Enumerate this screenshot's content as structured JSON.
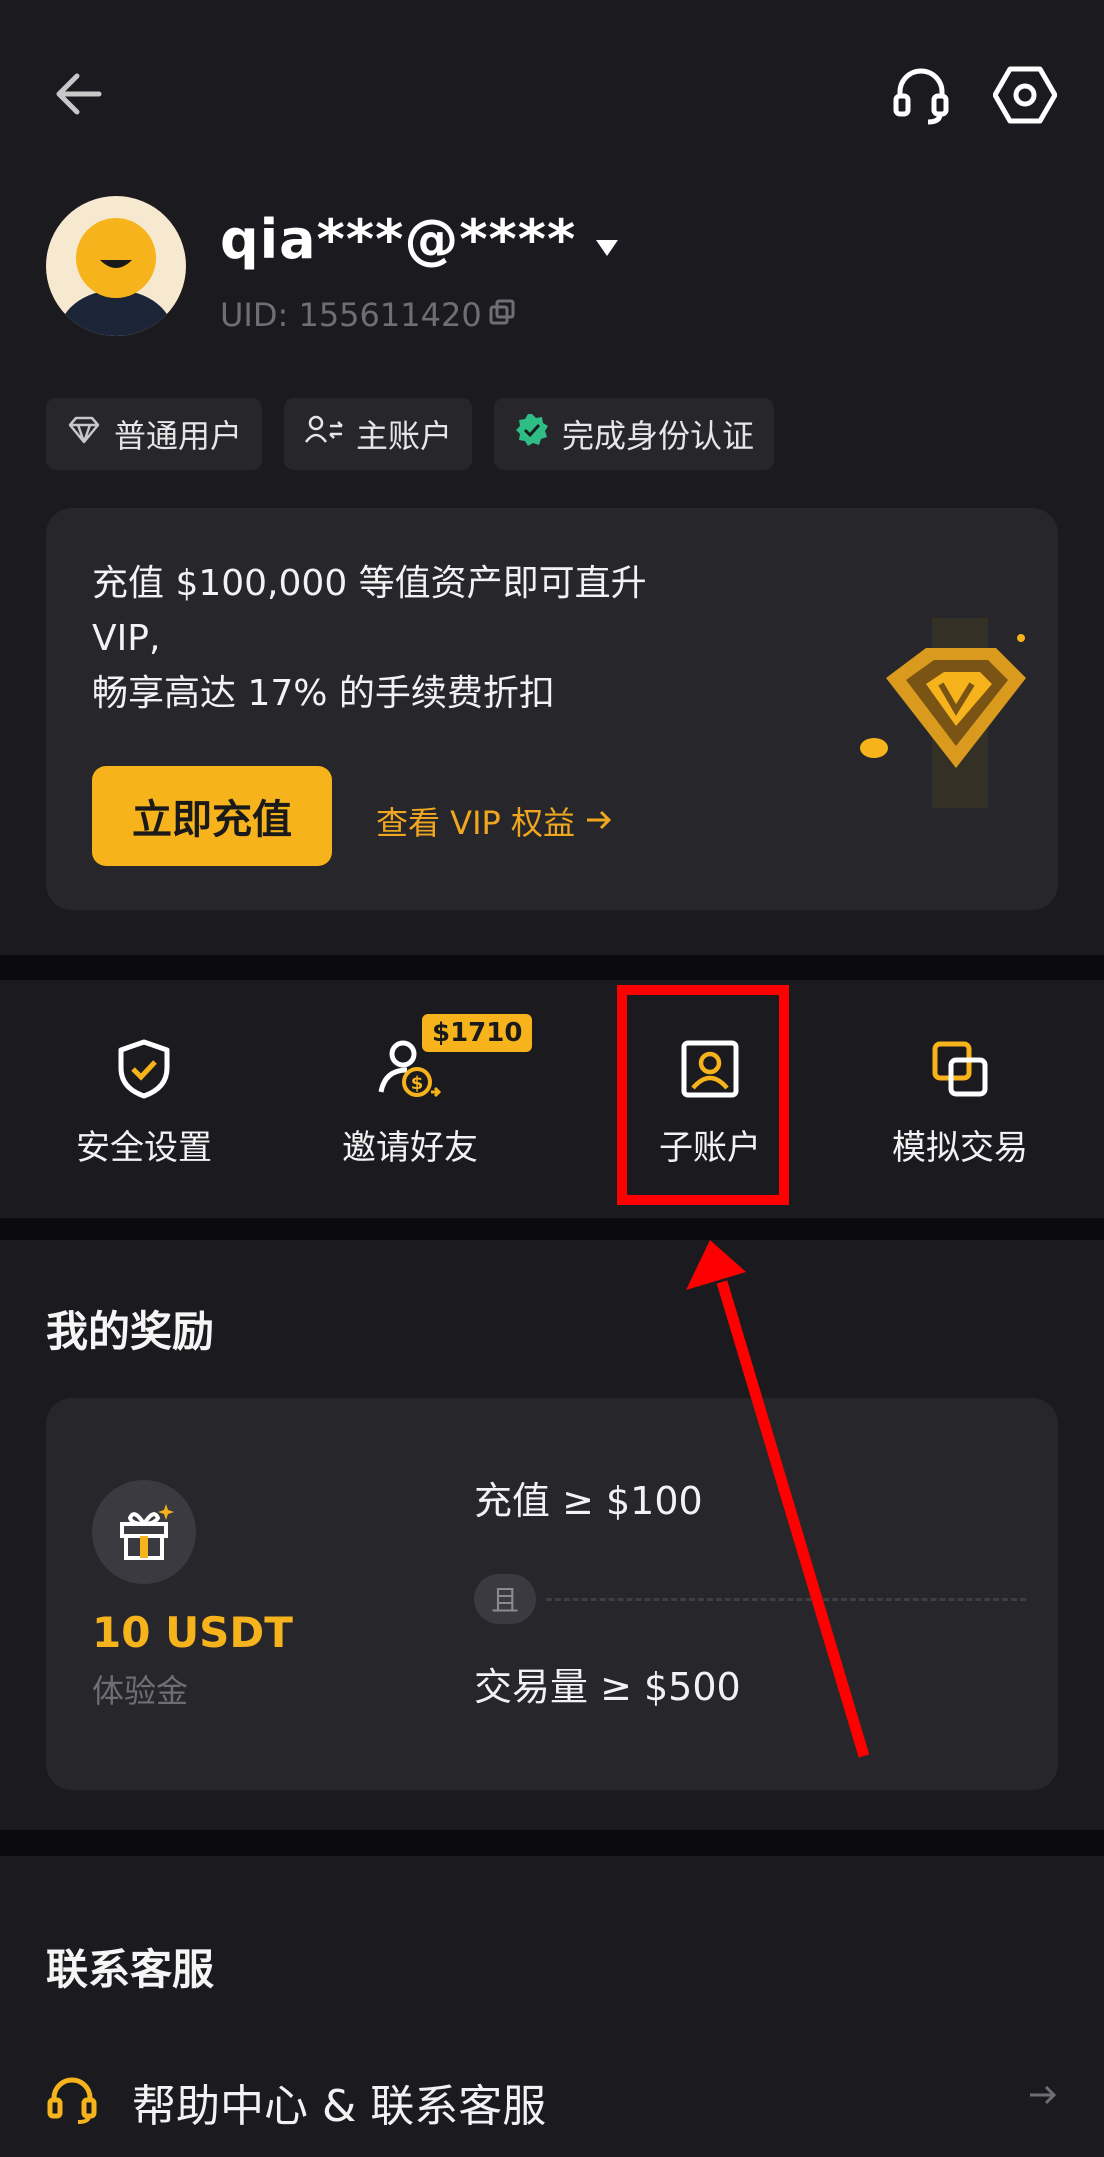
{
  "header": {
    "back_icon": "back-arrow-icon",
    "support_icon": "headset-icon",
    "settings_icon": "settings-hexagon-icon"
  },
  "profile": {
    "username": "qia***@****",
    "uid": "UID: 155611420",
    "tags": [
      {
        "label": "普通用户",
        "icon": "diamond-icon"
      },
      {
        "label": "主账户",
        "icon": "user-switch-icon"
      },
      {
        "label": "完成身份认证",
        "icon": "verified-badge-icon",
        "icon_color": "#2ebd85"
      }
    ]
  },
  "vip_card": {
    "text_line1": "充值 $100,000 等值资产即可直升",
    "text_line2": "VIP,",
    "text_line3": "畅享高达 17% 的手续费折扣",
    "button_label": "立即充值",
    "link_label": "查看 VIP 权益"
  },
  "actions": [
    {
      "label": "安全设置",
      "icon": "shield-check-icon"
    },
    {
      "label": "邀请好友",
      "icon": "invite-friend-icon",
      "badge": "$1710"
    },
    {
      "label": "子账户",
      "icon": "sub-account-icon"
    },
    {
      "label": "模拟交易",
      "icon": "demo-trading-icon"
    }
  ],
  "rewards": {
    "title": "我的奖励",
    "amount": "10 USDT",
    "amount_sub": "体验金",
    "condition1": "充值 ≥ $100",
    "and_label": "且",
    "condition2": "交易量 ≥ $500"
  },
  "contact": {
    "title": "联系客服",
    "help_label": "帮助中心 & 联系客服"
  },
  "colors": {
    "accent": "#f7b31b",
    "background": "#0b0b0e",
    "section": "#1b1b1f",
    "card": "#26262b",
    "annotation": "#ff0000"
  }
}
